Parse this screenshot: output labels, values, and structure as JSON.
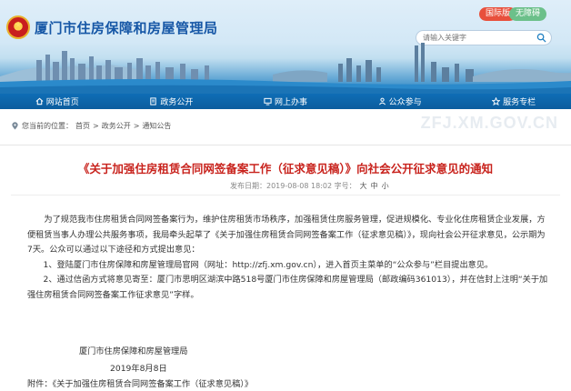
{
  "header": {
    "site_title": "厦门市住房保障和房屋管理局",
    "badge_red": "国际版",
    "badge_green": "无障碍",
    "search_placeholder": "请输入关键字"
  },
  "nav": {
    "items": [
      {
        "label": "网站首页",
        "icon": "home-icon"
      },
      {
        "label": "政务公开",
        "icon": "document-icon"
      },
      {
        "label": "网上办事",
        "icon": "computer-icon"
      },
      {
        "label": "公众参与",
        "icon": "people-icon"
      },
      {
        "label": "服务专栏",
        "icon": "star-icon"
      }
    ]
  },
  "breadcrumb": {
    "prefix": "您当前的位置：",
    "items": [
      "首页",
      "政务公开",
      "通知公告"
    ],
    "separator": ">",
    "watermark": "ZFJ.XM.GOV.CN"
  },
  "article": {
    "title": "《关于加强住房租赁合同网签备案工作（征求意见稿）》向社会公开征求意见的通知",
    "meta_label": "发布日期：2019-08-08 18:02 字号：",
    "font_large": "大",
    "font_medium": "中",
    "font_small": "小",
    "para1": "为了规范我市住房租赁合同网签备案行为，维护住房租赁市场秩序，加强租赁住房服务管理，促进规模化、专业化住房租赁企业发展，方便租赁当事人办理公共服务事项，我局牵头起草了《关于加强住房租赁合同网签备案工作（征求意见稿）》，现向社会公开征求意见，公示期为7天。公众可以通过以下途径和方式提出意见：",
    "item1": "1、登陆厦门市住房保障和房屋管理局官网（网址：http://zfj.xm.gov.cn），进入首页主菜单的“公众参与”栏目提出意见。",
    "item2": "2、通过信函方式将意见寄至：厦门市思明区湖滨中路518号厦门市住房保障和房屋管理局（邮政编码361013），并在信封上注明“关于加强住房租赁合同网签备案工作征求意见”字样。",
    "signature": "厦门市住房保障和房屋管理局",
    "date": "2019年8月8日",
    "attachment": "附件：《关于加强住房租赁合同网签备案工作（征求意见稿）》"
  },
  "colors": {
    "nav_bg": "#0f6db5",
    "title_red": "#c8221c",
    "site_title_blue": "#1657a6"
  }
}
